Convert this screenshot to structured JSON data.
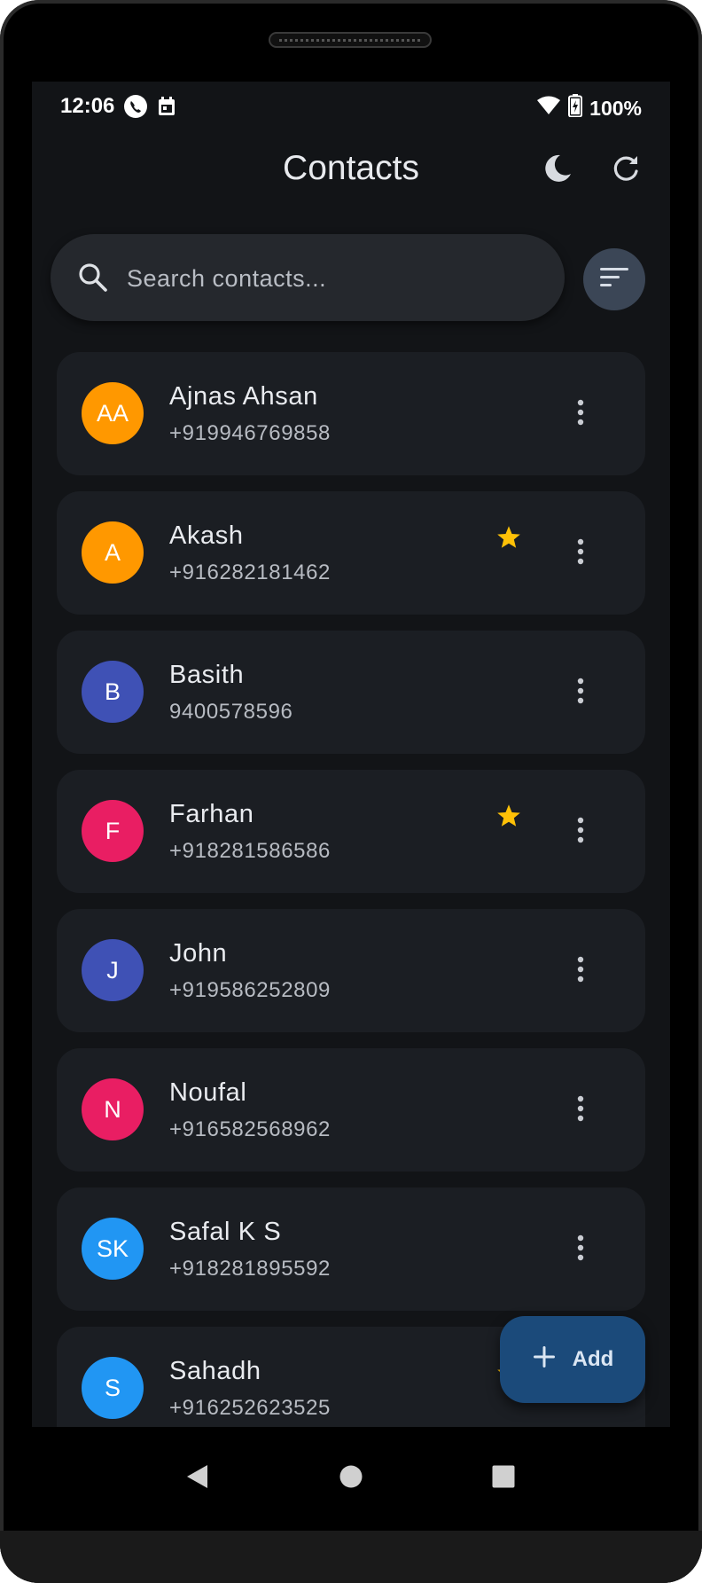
{
  "status_bar": {
    "time": "12:06",
    "battery": "100%"
  },
  "app_bar": {
    "title": "Contacts"
  },
  "search": {
    "placeholder": "Search contacts..."
  },
  "contacts": [
    {
      "initials": "AA",
      "name": "Ajnas Ahsan",
      "phone": "+919946769858",
      "favorite": false,
      "avatar_color": "#ff9800"
    },
    {
      "initials": "A",
      "name": "Akash",
      "phone": "+916282181462",
      "favorite": true,
      "avatar_color": "#ff9800"
    },
    {
      "initials": "B",
      "name": "Basith",
      "phone": "9400578596",
      "favorite": false,
      "avatar_color": "#3f51b5"
    },
    {
      "initials": "F",
      "name": "Farhan",
      "phone": "+918281586586",
      "favorite": true,
      "avatar_color": "#e91e63"
    },
    {
      "initials": "J",
      "name": "John",
      "phone": "+919586252809",
      "favorite": false,
      "avatar_color": "#3f51b5"
    },
    {
      "initials": "N",
      "name": "Noufal",
      "phone": "+916582568962",
      "favorite": false,
      "avatar_color": "#e91e63"
    },
    {
      "initials": "SK",
      "name": "Safal K S",
      "phone": "+918281895592",
      "favorite": false,
      "avatar_color": "#2196f3"
    },
    {
      "initials": "S",
      "name": "Sahadh",
      "phone": "+916252623525",
      "favorite": true,
      "avatar_color": "#2196f3"
    }
  ],
  "fab": {
    "label": "Add"
  },
  "colors": {
    "star": "#ffc107",
    "background": "#121417",
    "card": "#1b1e23",
    "fab": "#1b4a7a"
  }
}
